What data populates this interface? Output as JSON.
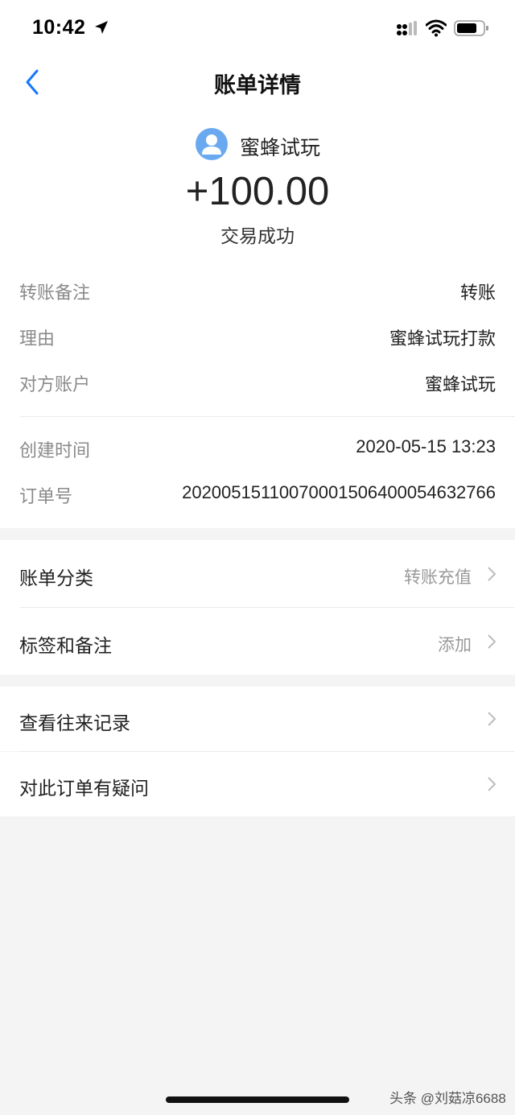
{
  "status_bar": {
    "time": "10:42"
  },
  "nav": {
    "title": "账单详情"
  },
  "header": {
    "payer_name": "蜜蜂试玩",
    "amount": "+100.00",
    "status": "交易成功"
  },
  "details": [
    {
      "label": "转账备注",
      "value": "转账"
    },
    {
      "label": "理由",
      "value": "蜜蜂试玩打款"
    },
    {
      "label": "对方账户",
      "value": "蜜蜂试玩"
    },
    {
      "label": "创建时间",
      "value": "2020-05-15 13:23"
    },
    {
      "label": "订单号",
      "value": "20200515110070001506400054632766"
    }
  ],
  "menu": [
    {
      "label": "账单分类",
      "value": "转账充值"
    },
    {
      "label": "标签和备注",
      "value": "添加"
    },
    {
      "label": "查看往来记录",
      "value": ""
    },
    {
      "label": "对此订单有疑问",
      "value": ""
    }
  ],
  "watermark": "头条 @刘菇凉6688",
  "colors": {
    "accent": "#1677ff",
    "avatar_bg": "#6aa9ef",
    "page_bg": "#f4f4f4"
  }
}
